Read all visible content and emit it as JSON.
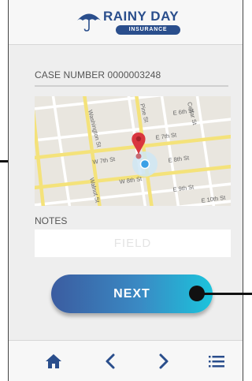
{
  "header": {
    "brand_title": "RAINY DAY",
    "brand_subtitle": "INSURANCE"
  },
  "case": {
    "label": "CASE NUMBER 0000003248"
  },
  "map": {
    "street_labels": [
      "Washington St",
      "Pine St",
      "E 6th St",
      "E 7th St",
      "W 7th St",
      "E 8th St",
      "W 8th St",
      "E 9th St",
      "E 10th St",
      "Walnut St",
      "Cedar St"
    ]
  },
  "notes": {
    "label": "NOTES",
    "placeholder": "FIELD",
    "value": ""
  },
  "actions": {
    "next_label": "NEXT"
  },
  "footer": {
    "icons": [
      "home-icon",
      "back-icon",
      "forward-icon",
      "menu-icon"
    ]
  },
  "colors": {
    "brand_blue": "#2a4e8c",
    "button_gradient_start": "#3b5ca0",
    "button_gradient_end": "#1bc4dc",
    "nav_icon": "#2a4e8c",
    "map_pin": "#d9363e",
    "map_location": "#3aa0e6"
  }
}
